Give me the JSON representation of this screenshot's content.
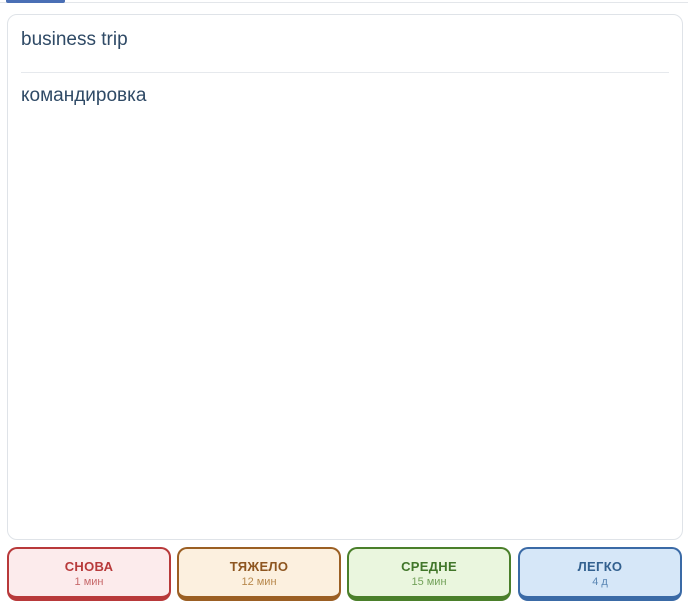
{
  "card": {
    "front": "business trip",
    "back": "командировка"
  },
  "progress": {
    "fraction": 0.09
  },
  "answers": {
    "again": {
      "label": "СНОВА",
      "interval": "1 мин",
      "color": "#b8393a"
    },
    "hard": {
      "label": "ТЯЖЕЛО",
      "interval": "12 мин",
      "color": "#9b5f23"
    },
    "good": {
      "label": "СРЕДНЕ",
      "interval": "15 мин",
      "color": "#4a7f2a"
    },
    "easy": {
      "label": "ЛЕГКО",
      "interval": "4 д",
      "color": "#3a6aa6"
    }
  }
}
